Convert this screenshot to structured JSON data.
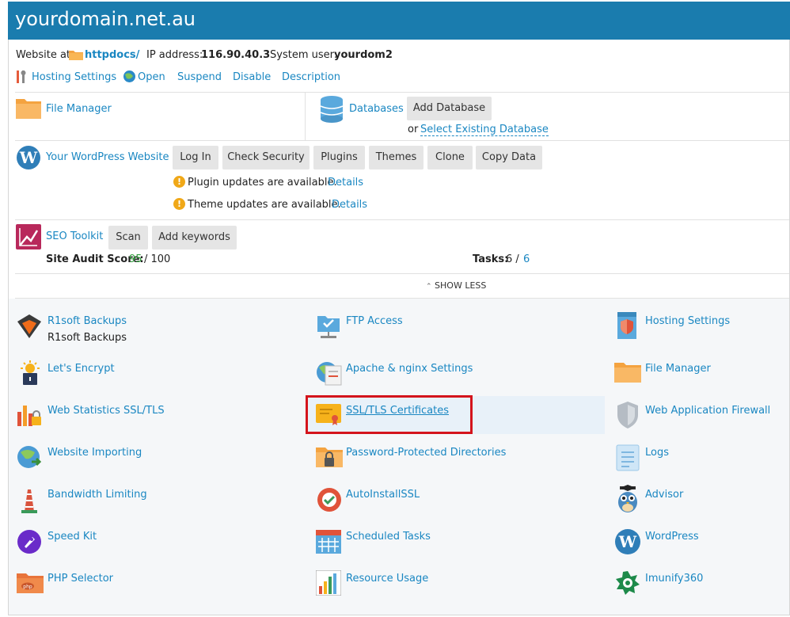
{
  "header": {
    "domain": "yourdomain.net.au"
  },
  "info": {
    "website_at_label": "Website at",
    "docroot": "httpdocs/",
    "ip_label": "IP address:",
    "ip": "116.90.40.3",
    "user_label": "System user:",
    "user": "yourdom2"
  },
  "actions": {
    "hosting_settings": "Hosting Settings",
    "open": "Open",
    "suspend": "Suspend",
    "disable": "Disable",
    "description": "Description"
  },
  "file_manager": {
    "label": "File Manager"
  },
  "databases": {
    "label": "Databases",
    "add_button": "Add Database",
    "or_text": "or",
    "select_existing": "Select Existing Database"
  },
  "wordpress": {
    "label": "Your WordPress Website",
    "buttons": [
      "Log In",
      "Check Security",
      "Plugins",
      "Themes",
      "Clone",
      "Copy Data"
    ],
    "notices": [
      {
        "text": "Plugin updates are available.",
        "link": "Details"
      },
      {
        "text": "Theme updates are available.",
        "link": "Details"
      }
    ]
  },
  "seo": {
    "label": "SEO Toolkit",
    "scan_button": "Scan",
    "keywords_button": "Add keywords",
    "audit_label": "Site Audit Score:",
    "audit_score": "95",
    "audit_total": "/ 100",
    "tasks_label": "Tasks:",
    "tasks_done": "6 /",
    "tasks_total": "6"
  },
  "show_less": "SHOW LESS",
  "tools": {
    "col1": [
      {
        "label": "R1soft Backups",
        "sub": "R1soft Backups",
        "icon": "r1soft-icon"
      },
      {
        "label": "Let's Encrypt",
        "icon": "lets-encrypt-icon"
      },
      {
        "label": "Web Statistics SSL/TLS",
        "icon": "web-statistics-icon"
      },
      {
        "label": "Website Importing",
        "icon": "website-importing-icon"
      },
      {
        "label": "Bandwidth Limiting",
        "icon": "bandwidth-icon"
      },
      {
        "label": "Speed Kit",
        "icon": "speed-kit-icon"
      },
      {
        "label": "PHP Selector",
        "icon": "php-selector-icon"
      }
    ],
    "col2": [
      {
        "label": "FTP Access",
        "icon": "ftp-icon"
      },
      {
        "label": "Apache & nginx Settings",
        "icon": "apache-icon"
      },
      {
        "label": "SSL/TLS Certificates",
        "icon": "certificate-icon"
      },
      {
        "label": "Password-Protected Directories",
        "icon": "protected-folder-icon"
      },
      {
        "label": "AutoInstallSSL",
        "icon": "autoinstallssl-icon"
      },
      {
        "label": "Scheduled Tasks",
        "icon": "calendar-icon"
      },
      {
        "label": "Resource Usage",
        "icon": "resource-usage-icon"
      }
    ],
    "col3": [
      {
        "label": "Hosting Settings",
        "icon": "hosting-settings-icon"
      },
      {
        "label": "File Manager",
        "icon": "folder-icon"
      },
      {
        "label": "Web Application Firewall",
        "icon": "shield-icon"
      },
      {
        "label": "Logs",
        "icon": "logs-icon"
      },
      {
        "label": "Advisor",
        "icon": "owl-icon"
      },
      {
        "label": "WordPress",
        "icon": "wordpress-icon"
      },
      {
        "label": "Imunify360",
        "icon": "imunify-icon"
      }
    ]
  },
  "colors": {
    "header": "#1a7cae",
    "link": "#1a87c2",
    "score_green": "#2e9e3a",
    "highlight_border": "#d4141c"
  }
}
